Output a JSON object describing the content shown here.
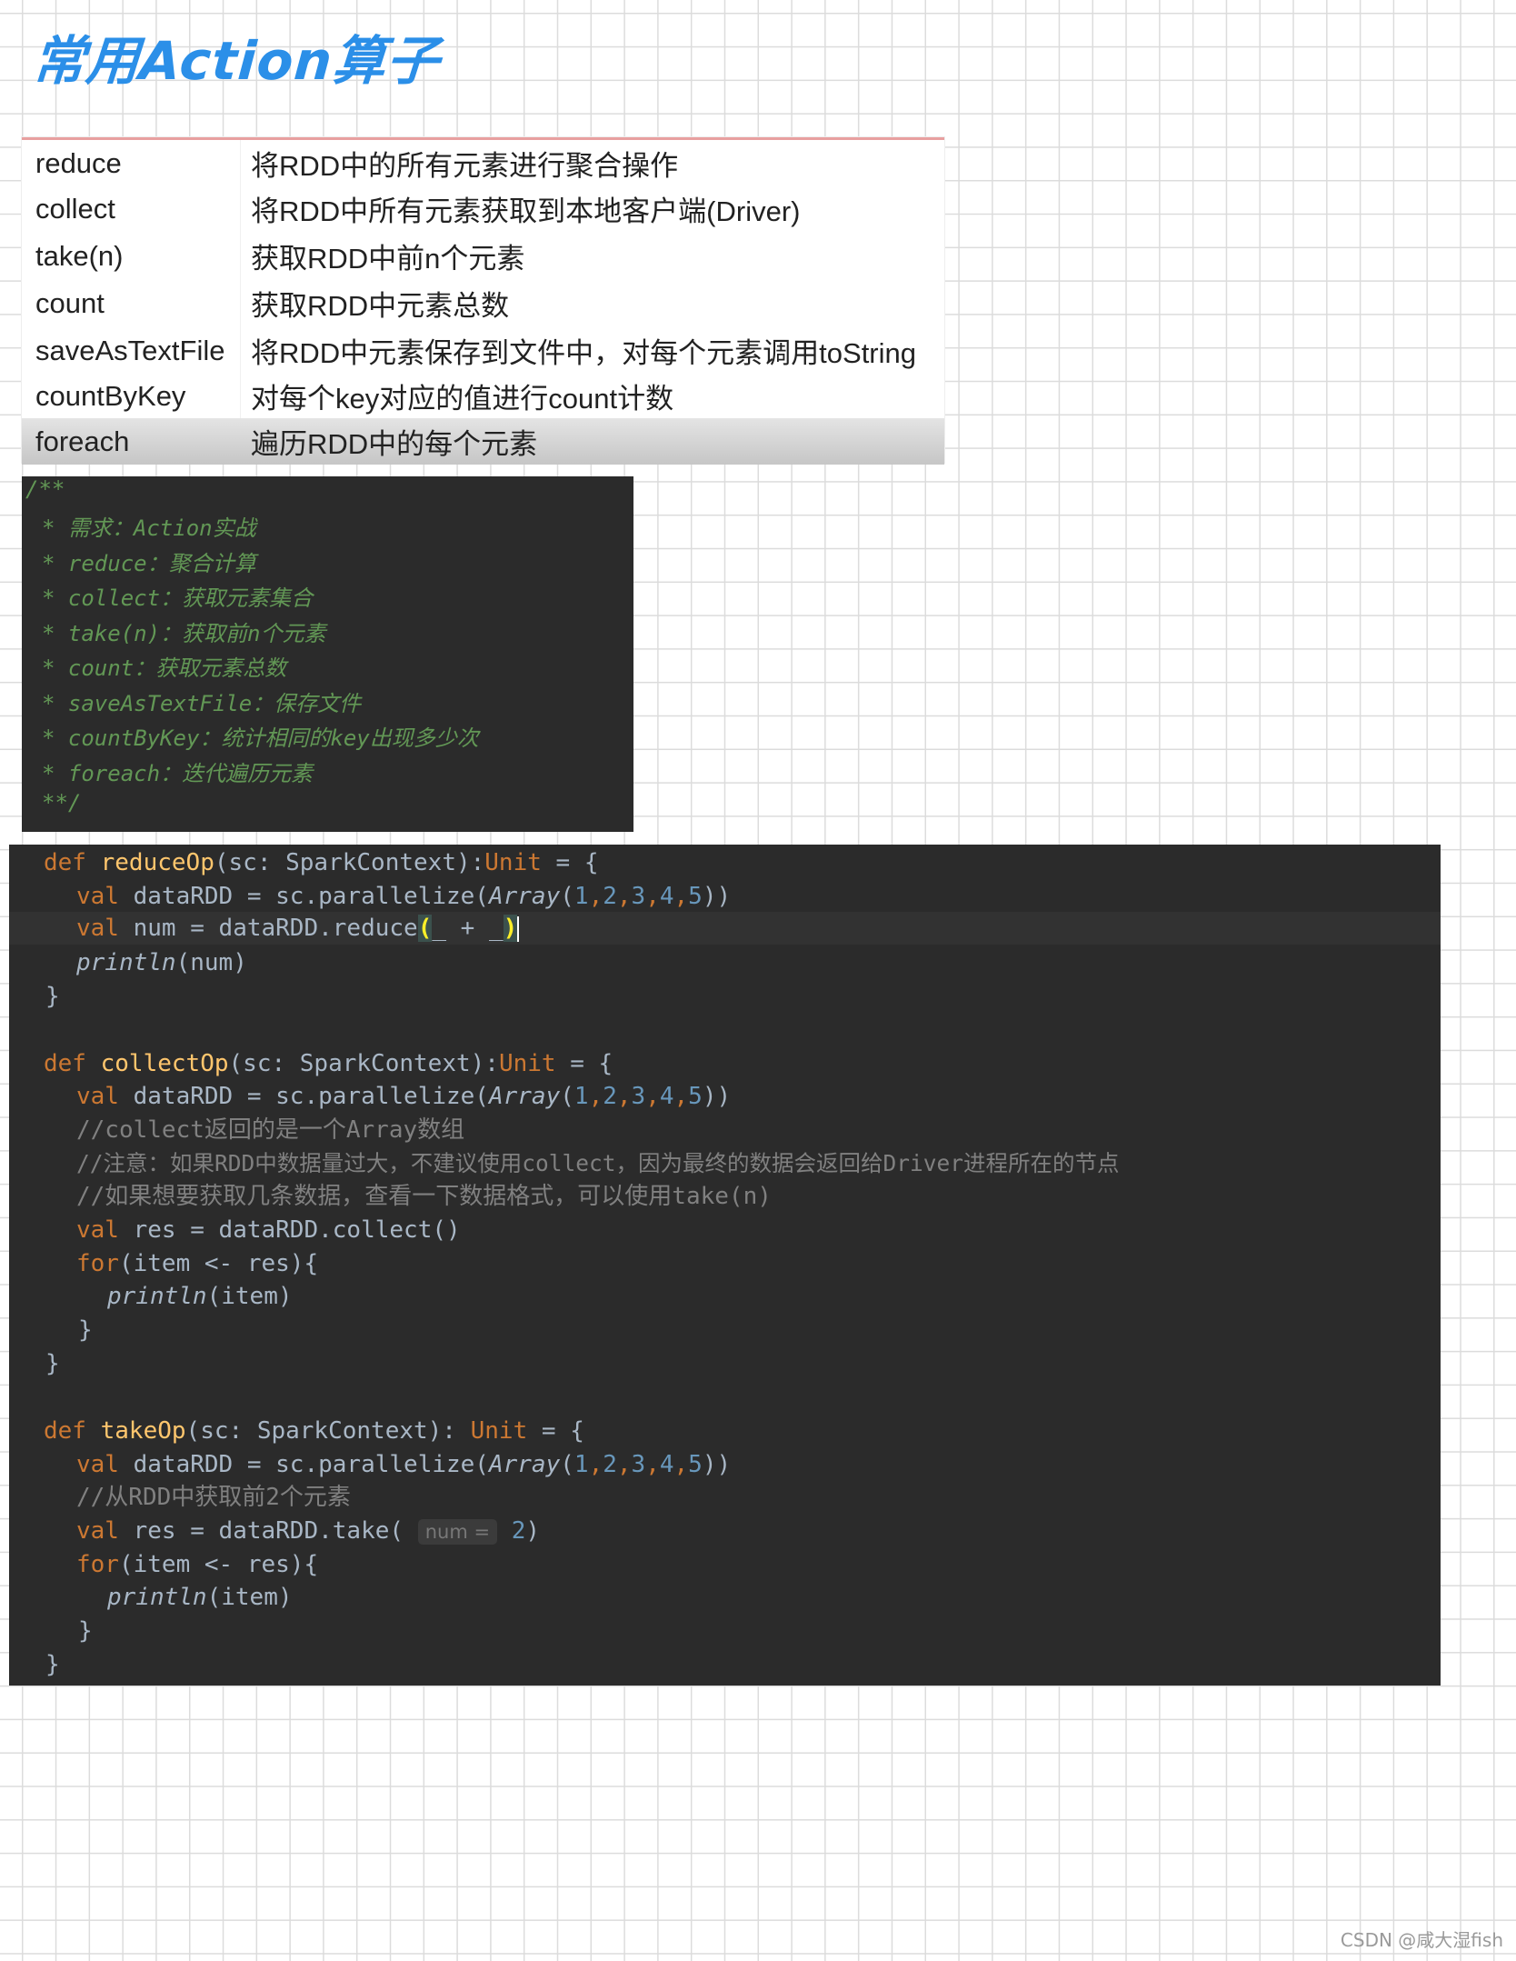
{
  "title": "常用Action算子",
  "table": {
    "rows": [
      {
        "name": "reduce",
        "desc": "将RDD中的所有元素进行聚合操作"
      },
      {
        "name": "collect",
        "desc": "将RDD中所有元素获取到本地客户端(Driver)"
      },
      {
        "name": "take(n)",
        "desc": "获取RDD中前n个元素"
      },
      {
        "name": "count",
        "desc": "获取RDD中元素总数"
      },
      {
        "name": "saveAsTextFile",
        "desc": "将RDD中元素保存到文件中，对每个元素调用toString"
      },
      {
        "name": "countByKey",
        "desc": "对每个key对应的值进行count计数"
      },
      {
        "name": "foreach",
        "desc": "遍历RDD中的每个元素"
      }
    ]
  },
  "comment": {
    "lines": [
      "/**",
      "* 需求：Action实战",
      "* reduce：聚合计算",
      "* collect：获取元素集合",
      "* take(n)：获取前n个元素",
      "* count：获取元素总数",
      "* saveAsTextFile：保存文件",
      "* countByKey：统计相同的key出现多少次",
      "* foreach：迭代遍历元素",
      "**/"
    ]
  },
  "code": {
    "reduce": {
      "def_kw": "def",
      "name": "reduceOp",
      "params": "(sc: SparkContext):",
      "ret": "Unit",
      "open": " = {",
      "data_rdd_prefix": "val",
      "data_rdd_body": " dataRDD = sc.parallelize(",
      "array_fn": "Array",
      "n1": "1",
      "n2": "2",
      "n3": "3",
      "n4": "4",
      "n5": "5",
      "num_kw": "val",
      "num_body": " num = dataRDD.reduce",
      "paren_open": "(",
      "lambda": "_ + _",
      "paren_close": ")",
      "print_fn": "println",
      "print_args": "(num)",
      "close": "}"
    },
    "collect": {
      "def_kw": "def",
      "name": "collectOp",
      "params": "(sc: SparkContext):",
      "ret": "Unit",
      "open": " = {",
      "comment1": "//collect返回的是一个Array数组",
      "comment2": "//注意：如果RDD中数据量过大，不建议使用collect，因为最终的数据会返回给Driver进程所在的节点",
      "comment3": "//如果想要获取几条数据，查看一下数据格式，可以使用take(n)",
      "res_kw": "val",
      "res_body": " res = dataRDD.collect()",
      "for_kw": "for",
      "for_body": "(item <- res){",
      "print_fn": "println",
      "print_args": "(item)",
      "inner_close": "}",
      "close": "}"
    },
    "take": {
      "def_kw": "def",
      "name": "takeOp",
      "params": "(sc: SparkContext): ",
      "ret": "Unit",
      "open": " = {",
      "comment1": "//从RDD中获取前2个元素",
      "res_kw": "val",
      "res_body": " res = dataRDD.take( ",
      "hint": "num =",
      "arg": "2",
      "res_end": ")",
      "for_kw": "for",
      "for_body": "(item <- res){",
      "print_fn": "println",
      "print_args": "(item)",
      "inner_close": "}",
      "close": "}"
    }
  },
  "watermark": "CSDN @咸大湿fish"
}
